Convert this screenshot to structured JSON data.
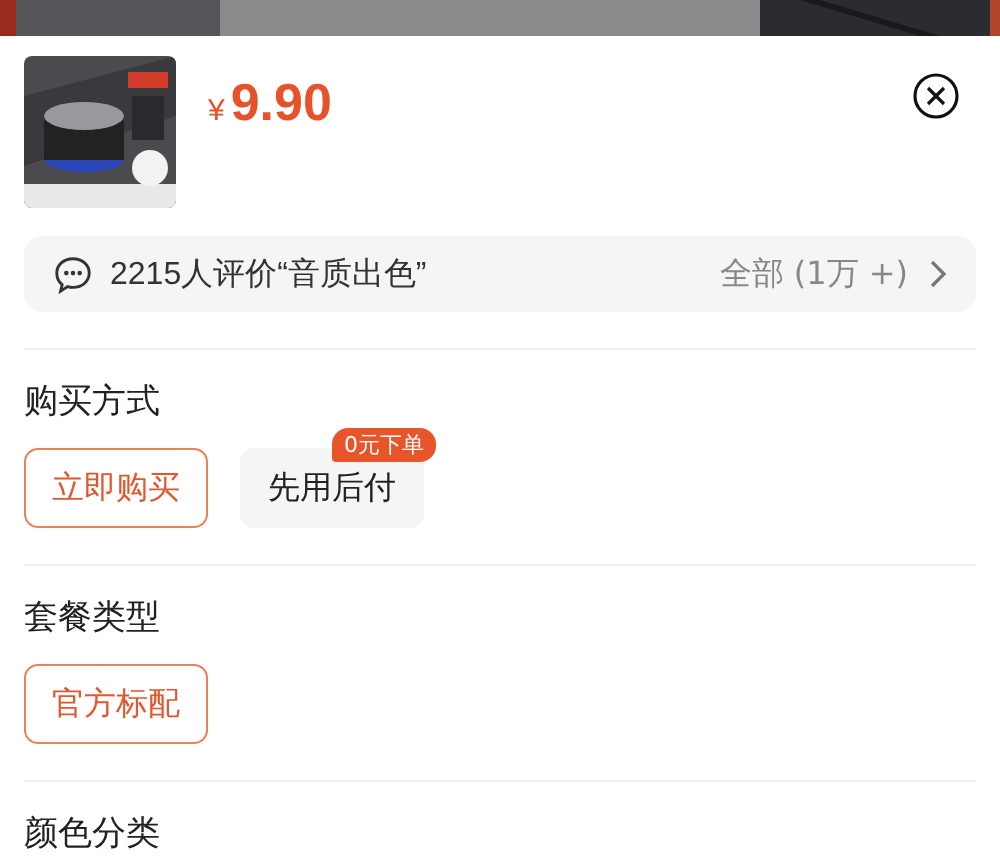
{
  "product": {
    "currency": "¥",
    "price": "9.90"
  },
  "reviews": {
    "summary": "2215人评价“音质出色”",
    "all": "全部 (1万 +)"
  },
  "sections": [
    {
      "title": "购买方式",
      "options": [
        {
          "label": "立即购买",
          "selected": true
        },
        {
          "label": "先用后付",
          "selected": false,
          "badge": "0元下单"
        }
      ]
    },
    {
      "title": "套餐类型",
      "options": [
        {
          "label": "官方标配",
          "selected": true
        }
      ]
    },
    {
      "title": "颜色分类"
    }
  ]
}
